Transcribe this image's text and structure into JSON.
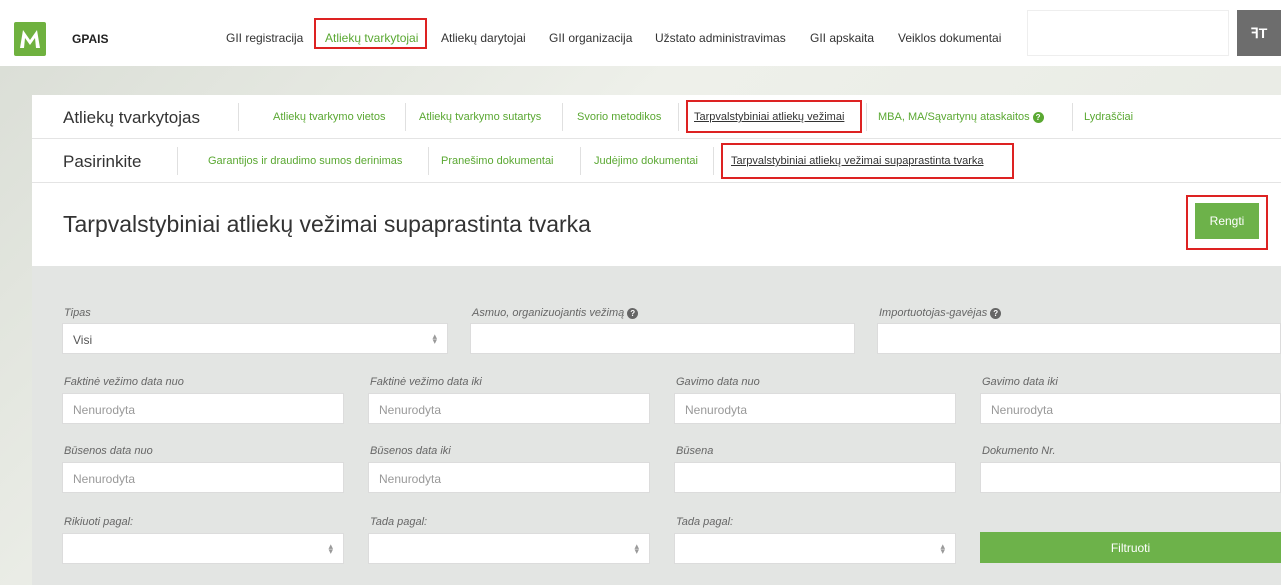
{
  "brand": "GPAIS",
  "topnav": [
    {
      "label": "GII registracija",
      "active": false
    },
    {
      "label": "Atliekų tvarkytojai",
      "active": true
    },
    {
      "label": "Atliekų darytojai",
      "active": false
    },
    {
      "label": "GII organizacija",
      "active": false
    },
    {
      "label": "Užstato administravimas",
      "active": false
    },
    {
      "label": "GII apskaita",
      "active": false
    },
    {
      "label": "Veiklos dokumentai",
      "active": false
    }
  ],
  "top_button_icon": "text-size-icon",
  "top_button_label": "ꟻT",
  "row1": {
    "heading": "Atliekų tvarkytojas",
    "tabs": [
      "Atliekų tvarkymo vietos",
      "Atliekų tvarkymo sutartys",
      "Svorio metodikos",
      "Tarpvalstybiniai atliekų vežimai",
      "MBA, MA/Sąvartynų ataskaitos",
      "Lydraščiai"
    ]
  },
  "row2": {
    "heading": "Pasirinkite",
    "tabs": [
      "Garantijos ir draudimo sumos derinimas",
      "Pranešimo dokumentai",
      "Judėjimo dokumentai",
      "Tarpvalstybiniai atliekų vežimai supaprastinta tvarka"
    ]
  },
  "page_title": "Tarpvalstybiniai atliekų vežimai supaprastinta tvarka",
  "rengti_label": "Rengti",
  "filters": {
    "tipas_label": "Tipas",
    "tipas_value": "Visi",
    "asmuo_label": "Asmuo, organizuojantis vežimą",
    "importuotojas_label": "Importuotojas-gavėjas",
    "faktine_nuo_label": "Faktinė vežimo data nuo",
    "faktine_iki_label": "Faktinė vežimo data iki",
    "gavimo_nuo_label": "Gavimo data nuo",
    "gavimo_iki_label": "Gavimo data iki",
    "busenos_nuo_label": "Būsenos data nuo",
    "busenos_iki_label": "Būsenos data iki",
    "busena_label": "Būsena",
    "dokumento_label": "Dokumento Nr.",
    "rikiuoti_label": "Rikiuoti pagal:",
    "tada1_label": "Tada pagal:",
    "tada2_label": "Tada pagal:",
    "placeholder": "Nenurodyta",
    "filtruoti_label": "Filtruoti"
  },
  "colors": {
    "accent": "#5aa832",
    "button": "#6db24a",
    "highlight": "#dd2222"
  }
}
